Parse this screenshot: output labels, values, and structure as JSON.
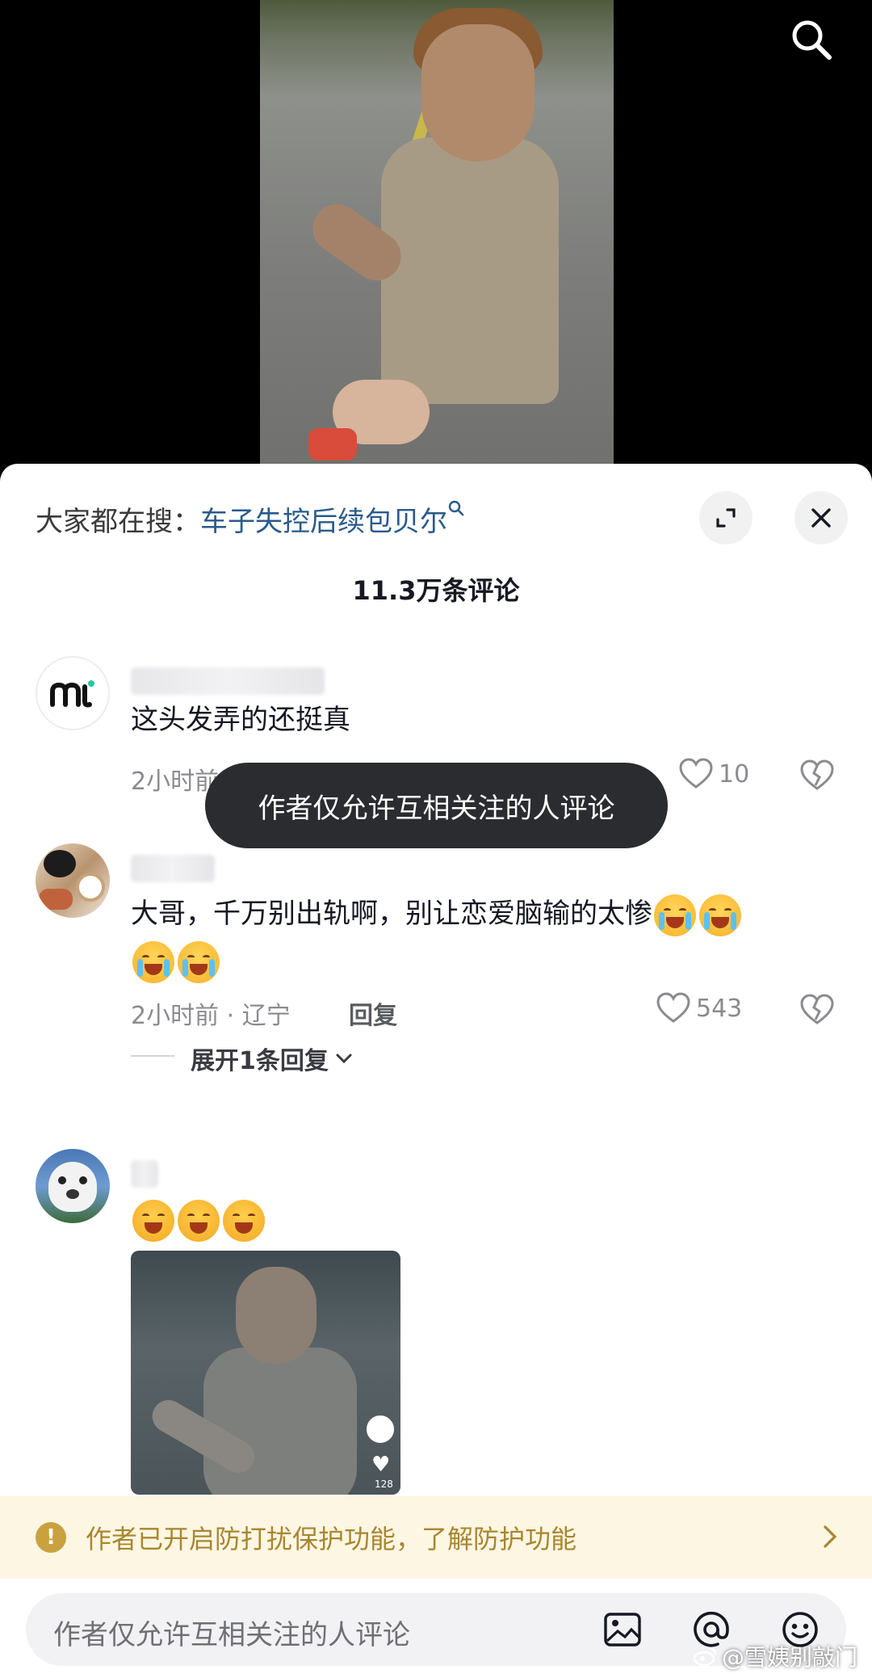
{
  "hot_search": {
    "prefix": "大家都在搜：",
    "keyword": "车子失控后续包贝尔",
    "suffix_icon": "search-icon"
  },
  "header": {
    "comment_count": "11.3万条评论"
  },
  "comments": [
    {
      "text": "这头发弄的还挺真",
      "meta": "2小时前",
      "likes": "10",
      "avatar": "brand-logo-avatar"
    },
    {
      "text": "大哥，千万别出轨啊，别让恋爱脑输的太惨",
      "meta": "2小时前 · 辽宁",
      "reply_label": "回复",
      "likes": "543",
      "expand_label": "展开1条回复"
    },
    {
      "text": "",
      "has_image": true
    }
  ],
  "toast": {
    "text": "作者仅允许互相关注的人评论"
  },
  "thumb": {
    "likes": "128"
  },
  "notice": {
    "text": "作者已开启防打扰保护功能，了解防护功能"
  },
  "input": {
    "placeholder": "作者仅允许互相关注的人评论"
  },
  "watermark": {
    "text": "@雪姨别敲门"
  },
  "colors": {
    "sheet_bg": "#ffffff",
    "link": "#2a5a8c",
    "notice_bg": "#fdf6e3",
    "notice_text": "#a9862e",
    "toast_bg": "#2b2c30"
  }
}
